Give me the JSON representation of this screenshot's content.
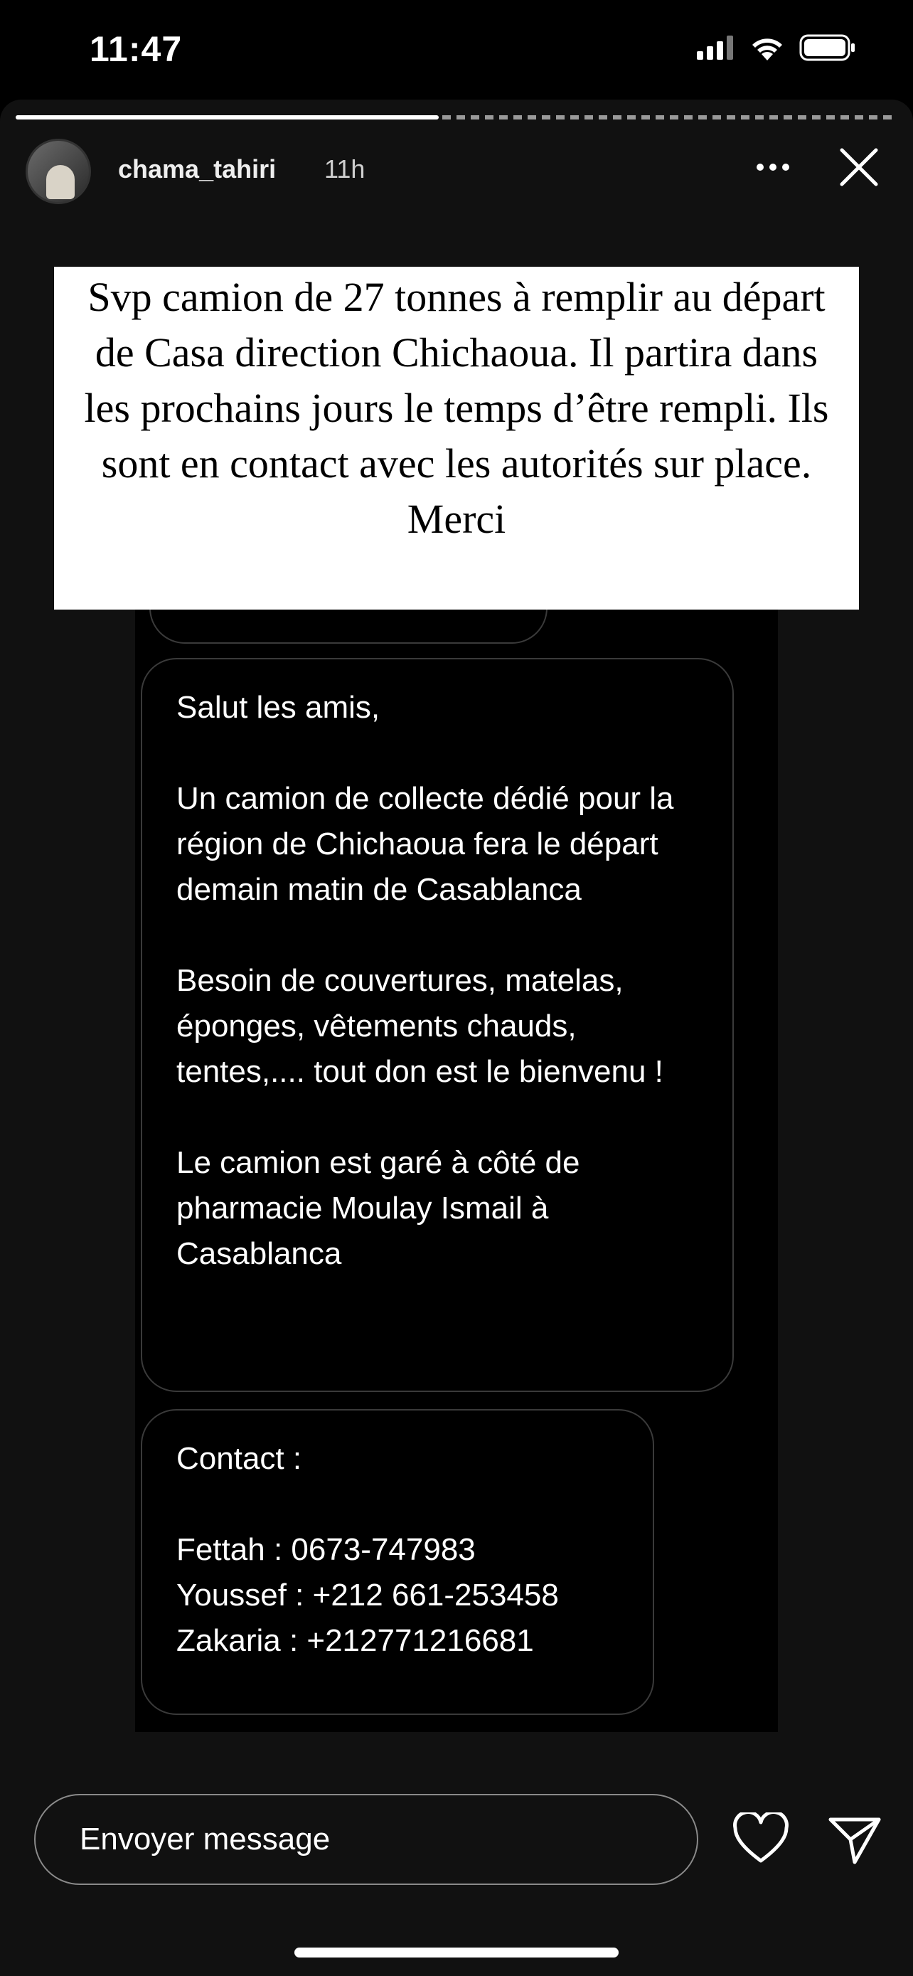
{
  "status_bar": {
    "time": "11:47",
    "icons": [
      "cellular-signal-icon",
      "wifi-icon",
      "battery-icon"
    ]
  },
  "story": {
    "username": "chama_tahiri",
    "time_ago": "11h",
    "caption": "Svp camion de 27 tonnes à remplir au départ de Casa direction Chichaoua. Il partira dans les prochains jours le temps d’être rempli. Ils sont en contact avec les autorités sur place. Merci",
    "progress": 0.48
  },
  "screenshot": {
    "message1": "Salut les amis,\n\nUn camion de collecte dédié pour la région de Chichaoua fera le départ demain matin de Casablanca\n\nBesoin de couvertures, matelas, éponges, vêtements chauds, tentes,.... tout don est le bienvenu !\n\nLe camion est garé à côté de pharmacie Moulay Ismail à Casablanca",
    "message2": "Contact :\n\nFettah : 0673-747983\nYoussef : +212 661-253458\nZakaria : +212771216681"
  },
  "reply": {
    "placeholder": "Envoyer message"
  },
  "colors": {
    "background": "#000000",
    "caption_bg": "#ffffff",
    "bubble_border": "#3a3a3a"
  }
}
